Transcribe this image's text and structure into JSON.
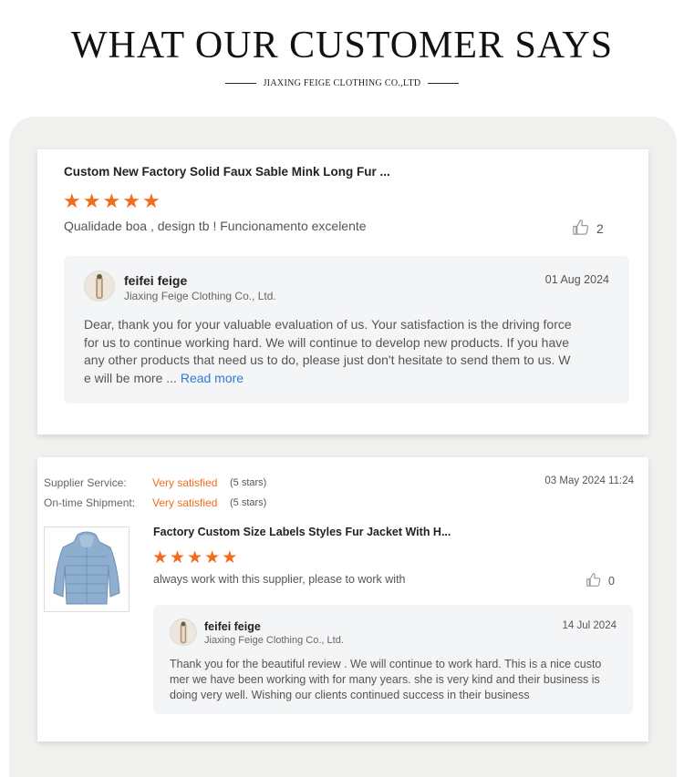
{
  "header": {
    "title": "WHAT OUR CUSTOMER SAYS",
    "subtitle": "JIAXING FEIGE CLOTHING CO.,LTD"
  },
  "review1": {
    "product_title": "Custom New Factory Solid Faux Sable Mink Long Fur ...",
    "rating": 5,
    "text": "Qualidade boa , design tb ! Funcionamento excelente",
    "likes": "2",
    "reply": {
      "name": "feifei feige",
      "company": "Jiaxing Feige Clothing Co., Ltd.",
      "date": "01 Aug 2024",
      "line1": "Dear, thank you for your valuable evaluation of us. Your satisfaction is the driving force",
      "line2": "for us to continue working hard. We will continue to develop new products. If you have",
      "line3": "any other products that need us to do, please just don't hesitate to send them to us. W",
      "line4": "e will be more ...",
      "read_more": "Read more"
    }
  },
  "review2": {
    "supplier_service_label": "Supplier Service:",
    "supplier_service_value": "Very satisfied",
    "supplier_service_stars": "(5 stars)",
    "shipment_label": "On-time Shipment:",
    "shipment_value": "Very satisfied",
    "shipment_stars": "(5 stars)",
    "date": "03 May 2024 11:24",
    "product_title": "Factory Custom Size Labels Styles Fur Jacket With H...",
    "rating": 5,
    "text": "always work with this supplier, please to work with",
    "likes": "0",
    "reply": {
      "name": "feifei feige",
      "company": "Jiaxing Feige Clothing Co., Ltd.",
      "date": "14 Jul 2024",
      "line1": "Thank you for the beautiful review . We will continue to work hard. This is a nice custo",
      "line2": "mer we have been working with for many years. she is very kind and their business is",
      "line3": "doing very well. Wishing our clients continued success in their business"
    }
  },
  "colors": {
    "star": "#f36b1c",
    "accent_orange": "#f36b1c",
    "link_blue": "#2f7ad6",
    "panel_bg": "#f0f0ee",
    "reply_bg": "#f4f5f7"
  },
  "icons": [
    "thumbs-up-icon",
    "star-icon",
    "avatar-icon"
  ]
}
